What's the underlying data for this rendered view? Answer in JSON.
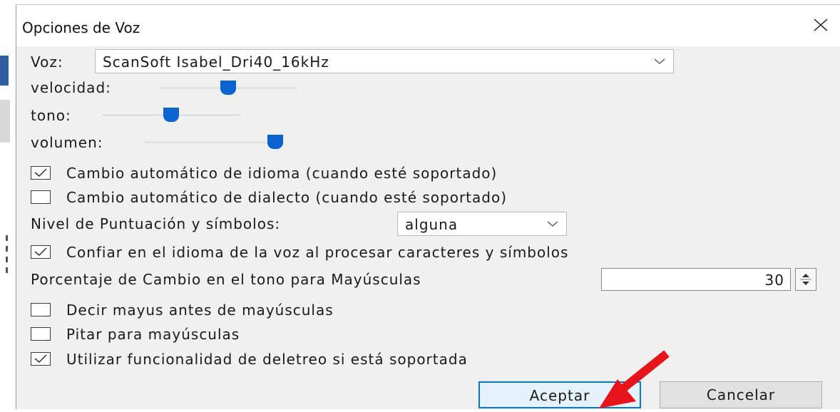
{
  "dialog": {
    "title": "Opciones de Voz"
  },
  "voice": {
    "label": "Voz:",
    "selected": "ScanSoft Isabel_Dri40_16kHz"
  },
  "sliders": {
    "rate_label": "velocidad:",
    "rate_level": 0.5,
    "pitch_label": "tono:",
    "pitch_level": 0.5,
    "volume_label": "volumen:",
    "volume_level": 1.0
  },
  "options": {
    "auto_language": {
      "label": "Cambio automático de idioma (cuando esté soportado)",
      "checked": true
    },
    "auto_dialect": {
      "label": "Cambio automático de dialecto (cuando esté soportado)",
      "checked": false
    },
    "punctuation_label": "Nivel de Puntuación y símbolos:",
    "punctuation_value": "alguna",
    "trust_voice_language": {
      "label": "Confiar en el idioma de la voz al procesar caracteres y símbolos",
      "checked": true
    },
    "cap_pitch_label": "Porcentaje de Cambio en el tono para Mayúsculas",
    "cap_pitch_value": "30",
    "say_cap": {
      "label": "Decir mayus antes de mayúsculas",
      "checked": false
    },
    "beep_caps": {
      "label": "Pitar para mayúsculas",
      "checked": false
    },
    "spelling": {
      "label": "Utilizar funcionalidad de deletreo si está soportada",
      "checked": true
    }
  },
  "buttons": {
    "ok": "Aceptar",
    "cancel": "Cancelar"
  },
  "colors": {
    "accent": "#0a63d0",
    "arrow": "#e8141b"
  }
}
